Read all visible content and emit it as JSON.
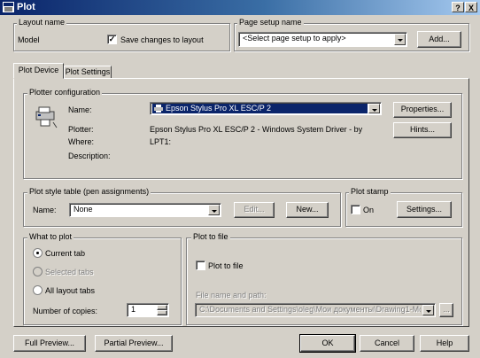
{
  "window": {
    "title": "Plot",
    "help_label": "?",
    "close_label": "X"
  },
  "layout_name": {
    "group_label": "Layout name",
    "value": "Model",
    "save_changes_label": "Save changes to layout",
    "save_changes_checked": true
  },
  "page_setup": {
    "group_label": "Page setup name",
    "value": "<Select page setup to apply>",
    "add_label": "Add..."
  },
  "tabs": [
    {
      "label": "Plot Device"
    },
    {
      "label": "Plot Settings"
    }
  ],
  "plotter_config": {
    "group_label": "Plotter configuration",
    "name_label": "Name:",
    "name_value": "Epson Stylus Pro XL ESC/P 2",
    "plotter_label": "Plotter:",
    "plotter_value": "Epson Stylus Pro XL ESC/P 2 - Windows System Driver - by",
    "where_label": "Where:",
    "where_value": "LPT1:",
    "description_label": "Description:",
    "properties_label": "Properties...",
    "hints_label": "Hints..."
  },
  "plot_style": {
    "group_label": "Plot style table (pen assignments)",
    "name_label": "Name:",
    "value": "None",
    "edit_label": "Edit...",
    "new_label": "New..."
  },
  "plot_stamp": {
    "group_label": "Plot stamp",
    "on_label": "On",
    "on_checked": false,
    "settings_label": "Settings..."
  },
  "what_to_plot": {
    "group_label": "What to plot",
    "options": [
      {
        "label": "Current tab",
        "selected": true,
        "enabled": true
      },
      {
        "label": "Selected tabs",
        "selected": false,
        "enabled": false
      },
      {
        "label": "All layout tabs",
        "selected": false,
        "enabled": true
      }
    ],
    "copies_label": "Number of copies:",
    "copies_value": "1"
  },
  "plot_to_file": {
    "group_label": "Plot to file",
    "checkbox_label": "Plot to file",
    "checked": false,
    "path_label": "File name and path:",
    "path_value": "C:\\Documents and Settings\\oleg\\Мои документы\\Drawing1-Mo",
    "browse_label": "..."
  },
  "footer": {
    "full_preview_label": "Full Preview...",
    "partial_preview_label": "Partial Preview...",
    "ok_label": "OK",
    "cancel_label": "Cancel",
    "help_label": "Help"
  },
  "colors": {
    "title_start": "#0a246a",
    "title_end": "#a6caf0",
    "face": "#d4d0c8",
    "selection": "#0a246a"
  }
}
